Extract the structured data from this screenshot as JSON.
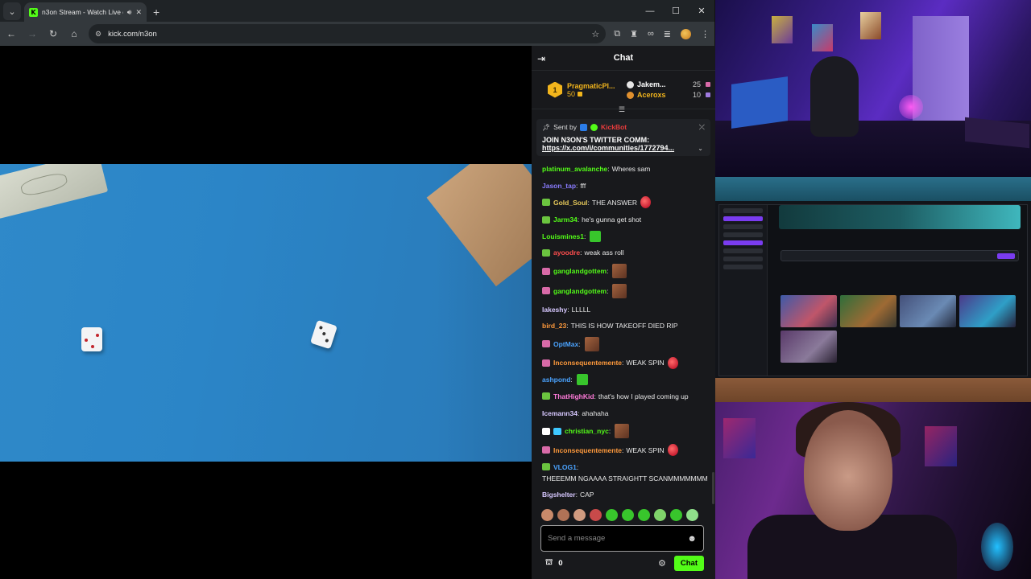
{
  "browser": {
    "tab_title": "n3on Stream - Watch Live o",
    "new_tab_symbol": "+",
    "url": "kick.com/n3on",
    "window_controls": [
      "minimize-icon",
      "maximize-icon",
      "close-icon"
    ]
  },
  "chat": {
    "title": "Chat",
    "leaderboard": {
      "first": {
        "rank": "1",
        "name": "PragmaticPl...",
        "score": "50"
      },
      "others": [
        {
          "name": "Jakem...",
          "score": "25",
          "color": "#ffffff"
        },
        {
          "name": "Aceroxs",
          "score": "10",
          "color": "#f2b51c"
        }
      ]
    },
    "pinned": {
      "sent_by_label": "Sent by",
      "sender": "KickBot",
      "message": "JOIN N3ON'S TWITTER COMM:",
      "link": "https://x.com/i/communities/1772794..."
    },
    "messages": [
      {
        "user": "platinum_avalanche",
        "color": "#53fc18",
        "text": "Wheres sam",
        "badges": [],
        "emote": null
      },
      {
        "user": "Jason_tap",
        "color": "#8a7cff",
        "text": "fff",
        "badges": [],
        "emote": null
      },
      {
        "user": "Gold_Soul",
        "color": "#e6c95a",
        "text": "THE ANSWER",
        "badges": [
          "#6bc43f"
        ],
        "emote": "red"
      },
      {
        "user": "Jarm34",
        "color": "#53fc18",
        "text": "he's gunna get shot",
        "badges": [
          "#6bc43f"
        ],
        "emote": null
      },
      {
        "user": "Louismines1",
        "color": "#53fc18",
        "text": "",
        "badges": [],
        "emote": "green"
      },
      {
        "user": "ayoodre",
        "color": "#ff4e4e",
        "text": "weak ass roll",
        "badges": [
          "#6bc43f"
        ],
        "emote": null
      },
      {
        "user": "ganglandgottem",
        "color": "#53fc18",
        "text": "",
        "badges": [
          "#d86aa8"
        ],
        "emote": "photo"
      },
      {
        "user": "ganglandgottem",
        "color": "#53fc18",
        "text": "",
        "badges": [
          "#d86aa8"
        ],
        "emote": "photo"
      },
      {
        "user": "lakeshy",
        "color": "#d7c8ff",
        "text": "LLLLL",
        "badges": [],
        "emote": null
      },
      {
        "user": "bird_23",
        "color": "#ff9a3c",
        "text": "THIS IS HOW TAKEOFF DIED RIP",
        "badges": [],
        "emote": null
      },
      {
        "user": "OptMax",
        "color": "#4aa3ff",
        "text": "",
        "badges": [
          "#d86aa8"
        ],
        "emote": "photo"
      },
      {
        "user": "Inconsequentemente",
        "color": "#ff9a3c",
        "text": "WEAK SPIN",
        "badges": [
          "#d86aa8"
        ],
        "emote": "red"
      },
      {
        "user": "ashpond",
        "color": "#4aa3ff",
        "text": "",
        "badges": [],
        "emote": "green"
      },
      {
        "user": "ThatHighKid",
        "color": "#ff7ad9",
        "text": "that's how I played coming up",
        "badges": [
          "#6bc43f"
        ],
        "emote": null
      },
      {
        "user": "Icemann34",
        "color": "#d7c8ff",
        "text": "ahahaha",
        "badges": [],
        "emote": null
      },
      {
        "user": "christian_nyc",
        "color": "#53fc18",
        "text": "",
        "badges": [
          "#ffffff",
          "#3ec8ff"
        ],
        "emote": "photo"
      },
      {
        "user": "Inconsequentemente",
        "color": "#ff9a3c",
        "text": "WEAK SPIN",
        "badges": [
          "#d86aa8"
        ],
        "emote": "red"
      },
      {
        "user": "VLOG1",
        "color": "#4aa3ff",
        "text": "THEEEMM NGAAAA STRAIGHTT SCANMMMMMMM",
        "badges": [
          "#6bc43f"
        ],
        "emote": null
      },
      {
        "user": "Bigshelter",
        "color": "#d7c8ff",
        "text": "CAP",
        "badges": [],
        "emote": null
      },
      {
        "user": "champ0380",
        "color": "#ff4e4e",
        "text": "",
        "badges": [
          "#d86aa8"
        ],
        "emote": "photo"
      }
    ],
    "emote_bar": [
      "#c98a6a",
      "#b07256",
      "#d19b80",
      "#c94a4a",
      "#38c52c",
      "#38c52c",
      "#38c52c",
      "#7fd36a",
      "#38c52c",
      "#8fe08a"
    ],
    "input_placeholder": "Send a message",
    "points": "0",
    "send_label": "Chat"
  },
  "colors": {
    "kick_green": "#53fc18",
    "chat_bg": "#18191c"
  }
}
